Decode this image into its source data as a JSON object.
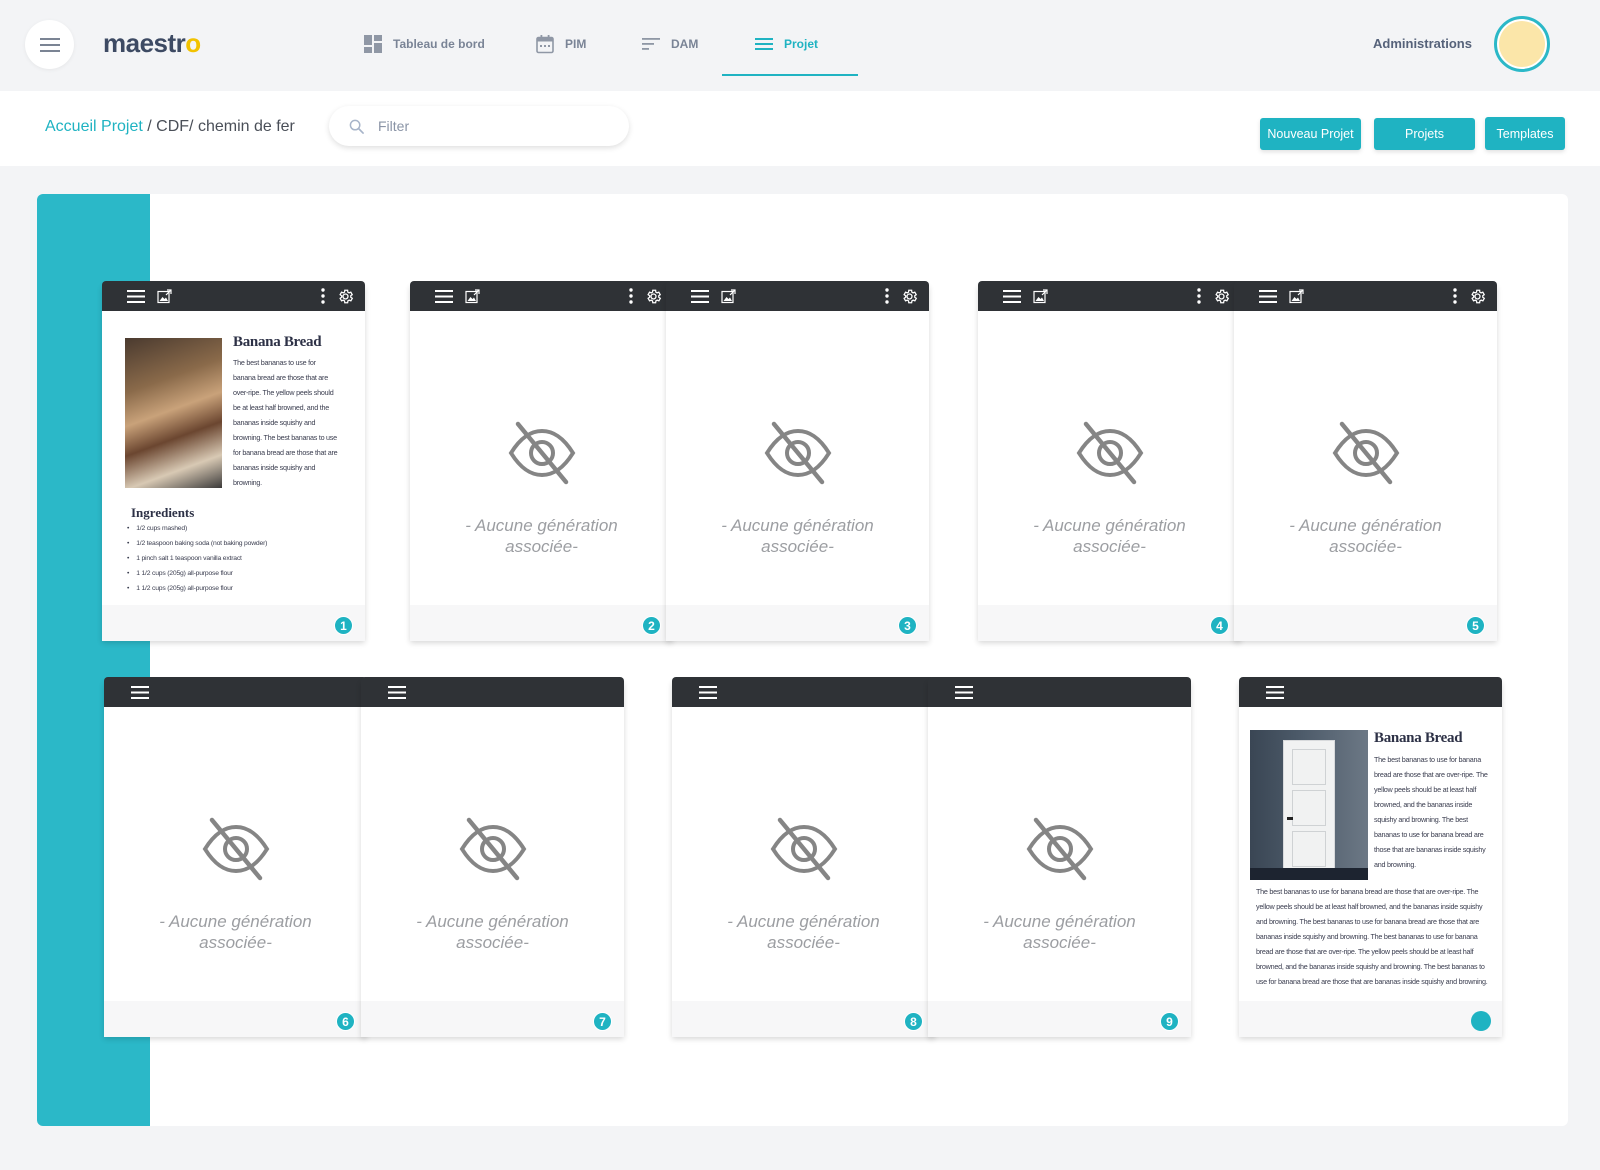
{
  "app": {
    "logo_main": "maestr",
    "logo_accent": "o"
  },
  "nav": {
    "items": [
      {
        "label": "Tableau de bord",
        "icon": "dashboard-icon"
      },
      {
        "label": "PIM",
        "icon": "calendar-icon"
      },
      {
        "label": "DAM",
        "icon": "sort-lines-icon"
      },
      {
        "label": "Projet",
        "icon": "list-icon",
        "active": true
      }
    ],
    "admin_label": "Administrations"
  },
  "breadcrumb": {
    "root": "Accueil Projet",
    "separator": " / ",
    "path": "CDF/ chemin de fer"
  },
  "filter": {
    "placeholder": "Filter",
    "value": ""
  },
  "actions": {
    "new_project": "Nouveau Projet",
    "projects": "Projets",
    "templates": "Templates"
  },
  "empty_text": "- Aucune génération associée-",
  "recipe": {
    "title": "Banana Bread",
    "body_1": "The best bananas to use for banana bread are those that are over-ripe. The yellow peels should be at least half browned, and the bananas inside squishy and browning. The best bananas to use for banana bread are those that are bananas inside squishy and browning.",
    "ingredients_title": "Ingredients",
    "ingredients": [
      "1/2 cups mashed)",
      "1/2 teaspoon baking soda (not baking powder)",
      "1 pinch salt 1 teaspoon vanilla extract",
      "1 1/2 cups (205g) all-purpose flour",
      "1 1/2 cups (205g) all-purpose flour"
    ],
    "body_2": "The best bananas to use for banana bread are those that are over-ripe. The yellow peels should be at least half browned, and the bananas inside squishy and browning. The best bananas to use for banana bread are those that are bananas inside squishy and browning.",
    "body_3": "The best bananas to use for banana bread are those that are over-ripe. The yellow peels should be at least half browned, and the bananas inside squishy and browning. The best bananas to use for banana bread are those that are bananas inside squishy and browning. The best bananas to use for banana bread are those that are over-ripe. The yellow peels should be at least half browned, and the bananas inside squishy and browning. The best bananas to use for banana bread are those that are bananas inside squishy and browning."
  },
  "pages": [
    {
      "number": "1",
      "content": "recipe"
    },
    {
      "number": "2",
      "content": "empty"
    },
    {
      "number": "3",
      "content": "empty"
    },
    {
      "number": "4",
      "content": "empty"
    },
    {
      "number": "5",
      "content": "empty"
    },
    {
      "number": "6",
      "content": "empty"
    },
    {
      "number": "7",
      "content": "empty"
    },
    {
      "number": "8",
      "content": "empty"
    },
    {
      "number": "9",
      "content": "empty"
    },
    {
      "number": "",
      "content": "recipe-door"
    }
  ],
  "colors": {
    "accent": "#1fb3c2",
    "toolbar": "#2f3236",
    "strip": "#2bb8c8",
    "logo_accent": "#f2c200"
  }
}
